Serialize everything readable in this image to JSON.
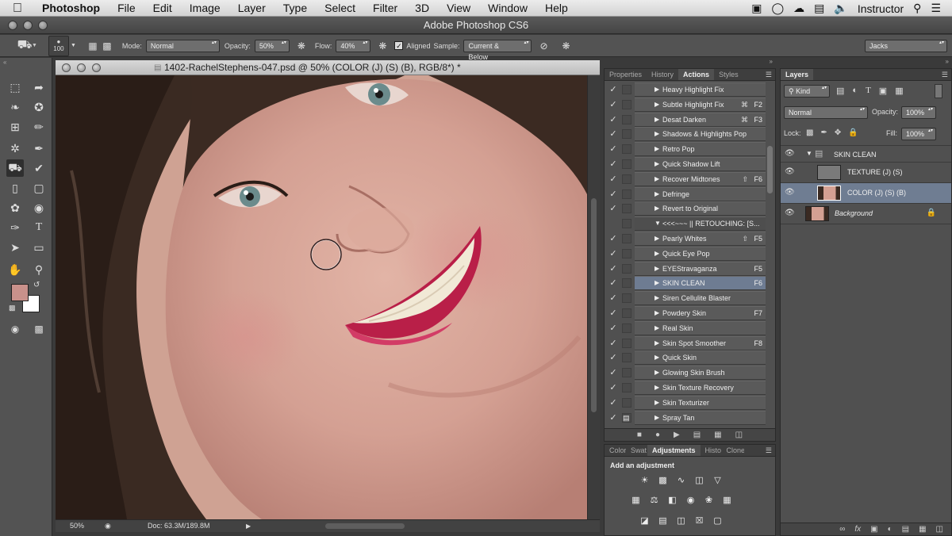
{
  "menubar": {
    "apple": "",
    "app_name": "Photoshop",
    "items": [
      "File",
      "Edit",
      "Image",
      "Layer",
      "Type",
      "Select",
      "Filter",
      "3D",
      "View",
      "Window",
      "Help"
    ],
    "user": "Instructor"
  },
  "window_title": "Adobe Photoshop CS6",
  "options": {
    "brush_size": "100",
    "mode_label": "Mode:",
    "mode_value": "Normal",
    "opacity_label": "Opacity:",
    "opacity_value": "50%",
    "flow_label": "Flow:",
    "flow_value": "40%",
    "aligned_label": "Aligned",
    "aligned_checked": true,
    "sample_label": "Sample:",
    "sample_value": "Current & Below",
    "workspace_value": "Jacks"
  },
  "document": {
    "title": "1402-RachelStephens-047.psd @ 50% (COLOR (J) (S) (B), RGB/8*) *",
    "zoom": "50%",
    "doc_size": "Doc: 63.3M/189.8M"
  },
  "actions_panel": {
    "tabs": [
      "Properties",
      "History",
      "Actions",
      "Styles"
    ],
    "active_tab": "Actions",
    "rows": [
      {
        "name": "Heavy Highlight Fix",
        "mod": "",
        "key": "",
        "type": "action"
      },
      {
        "name": "Subtle Highlight Fix",
        "mod": "⌘",
        "key": "F2",
        "type": "action"
      },
      {
        "name": "Desat Darken",
        "mod": "⌘",
        "key": "F3",
        "type": "action"
      },
      {
        "name": "Shadows & Highlights Pop",
        "mod": "",
        "key": "",
        "type": "action"
      },
      {
        "name": "Retro Pop",
        "mod": "",
        "key": "",
        "type": "action"
      },
      {
        "name": "Quick Shadow Lift",
        "mod": "",
        "key": "",
        "type": "action"
      },
      {
        "name": "Recover Midtones",
        "mod": "⇧",
        "key": "F6",
        "type": "action"
      },
      {
        "name": "Defringe",
        "mod": "",
        "key": "",
        "type": "action"
      },
      {
        "name": "Revert to Original",
        "mod": "",
        "key": "",
        "type": "action"
      },
      {
        "name": "<<<~~~ || RETOUCHING: [S...",
        "mod": "",
        "key": "",
        "type": "set"
      },
      {
        "name": "Pearly Whites",
        "mod": "⇧",
        "key": "F5",
        "type": "action"
      },
      {
        "name": "Quick Eye Pop",
        "mod": "",
        "key": "",
        "type": "action"
      },
      {
        "name": "EYEStravaganza",
        "mod": "",
        "key": "F5",
        "type": "action"
      },
      {
        "name": "SKIN CLEAN",
        "mod": "",
        "key": "F6",
        "type": "selected"
      },
      {
        "name": "Siren Cellulite Blaster",
        "mod": "",
        "key": "",
        "type": "action"
      },
      {
        "name": "Powdery Skin",
        "mod": "",
        "key": "F7",
        "type": "action"
      },
      {
        "name": "Real Skin",
        "mod": "",
        "key": "",
        "type": "action"
      },
      {
        "name": "Skin Spot Smoother",
        "mod": "",
        "key": "F8",
        "type": "action"
      },
      {
        "name": "Quick Skin",
        "mod": "",
        "key": "",
        "type": "action"
      },
      {
        "name": "Glowing Skin Brush",
        "mod": "",
        "key": "",
        "type": "action"
      },
      {
        "name": "Skin Texture Recovery",
        "mod": "",
        "key": "",
        "type": "action"
      },
      {
        "name": "Skin Texturizer",
        "mod": "",
        "key": "",
        "type": "action"
      },
      {
        "name": "Spray Tan",
        "mod": "",
        "key": "",
        "type": "action"
      }
    ]
  },
  "adjustments_panel": {
    "tabs": [
      "Color",
      "Swat",
      "Adjustments",
      "Histo",
      "Clone"
    ],
    "active_tab": "Adjustments",
    "heading": "Add an adjustment"
  },
  "layers_panel": {
    "tab": "Layers",
    "filter_value": "Kind",
    "blend_value": "Normal",
    "opacity_label": "Opacity:",
    "opacity_value": "100%",
    "lock_label": "Lock:",
    "fill_label": "Fill:",
    "fill_value": "100%",
    "layers": [
      {
        "name": "SKIN CLEAN",
        "kind": "group"
      },
      {
        "name": "TEXTURE (J) (S)",
        "kind": "layer"
      },
      {
        "name": "COLOR (J) (S) (B)",
        "kind": "layer",
        "selected": true
      },
      {
        "name": "Background",
        "kind": "background",
        "locked": true
      }
    ]
  },
  "colors": {
    "foreground": "#c9918b",
    "background": "#ffffff",
    "selection": "#6f7d92"
  }
}
